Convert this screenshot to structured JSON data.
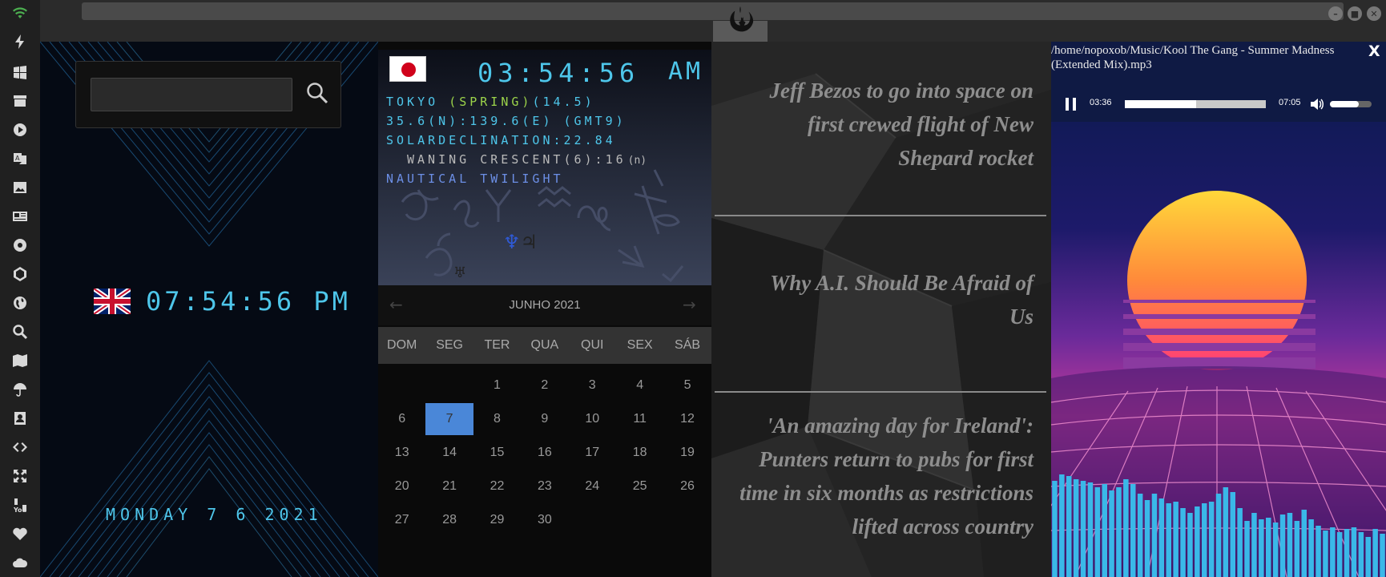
{
  "sidebar": {
    "icons": [
      "wifi-icon",
      "power-icon",
      "windows-icon",
      "archive-icon",
      "play-icon",
      "translate-icon",
      "image-icon",
      "newspaper-icon",
      "settings-icon",
      "hexagon-icon",
      "globe-icon",
      "search-icon",
      "map-icon",
      "umbrella-icon",
      "contacts-icon",
      "code-icon",
      "expand-icon",
      "youtube-icon",
      "heart-icon",
      "cloud-icon"
    ]
  },
  "uk_clock": {
    "time": "07:54:56 PM",
    "date": "MONDAY 7 6 2021",
    "search_placeholder": ""
  },
  "tokyo": {
    "time": "03:54:56",
    "ampm": "AM",
    "location_prefix": "TOKYO ",
    "season": "(SPRING)",
    "temp": "(14.5)",
    "coords": "35.6(N):139.6(E) (GMT9)",
    "declination": "SOLARDECLINATION:22.84",
    "moon": "WANING CRESCENT(6):16",
    "moon_suffix": "(n)",
    "twilight": "NAUTICAL TWILIGHT",
    "planets": [
      "♆",
      "♃"
    ],
    "uranus": "♅"
  },
  "calendar": {
    "month": "JUNHO 2021",
    "prev": "←",
    "next": "→",
    "weekdays": [
      "DOM",
      "SEG",
      "TER",
      "QUA",
      "QUI",
      "SEX",
      "SÁB"
    ],
    "leading_blanks": 2,
    "days": [
      "1",
      "2",
      "3",
      "4",
      "5",
      "6",
      "7",
      "8",
      "9",
      "10",
      "11",
      "12",
      "13",
      "14",
      "15",
      "16",
      "17",
      "18",
      "19",
      "20",
      "21",
      "22",
      "23",
      "24",
      "25",
      "26",
      "27",
      "28",
      "29",
      "30"
    ],
    "selected": "7"
  },
  "news": {
    "items": [
      "Jeff Bezos to go into space on first crewed flight of New Shepard rocket",
      "Why A.I. Should Be Afraid of Us",
      "'An amazing day for Ireland': Punters return to pubs for first time in six months as restrictions lifted across country"
    ]
  },
  "player": {
    "title": "/home/nopoxob/Music/Kool The Gang - Summer Madness (Extended Mix).mp3",
    "current": "03:36",
    "duration": "07:05",
    "progress": 0.508,
    "volume": 0.7,
    "close": "X"
  }
}
